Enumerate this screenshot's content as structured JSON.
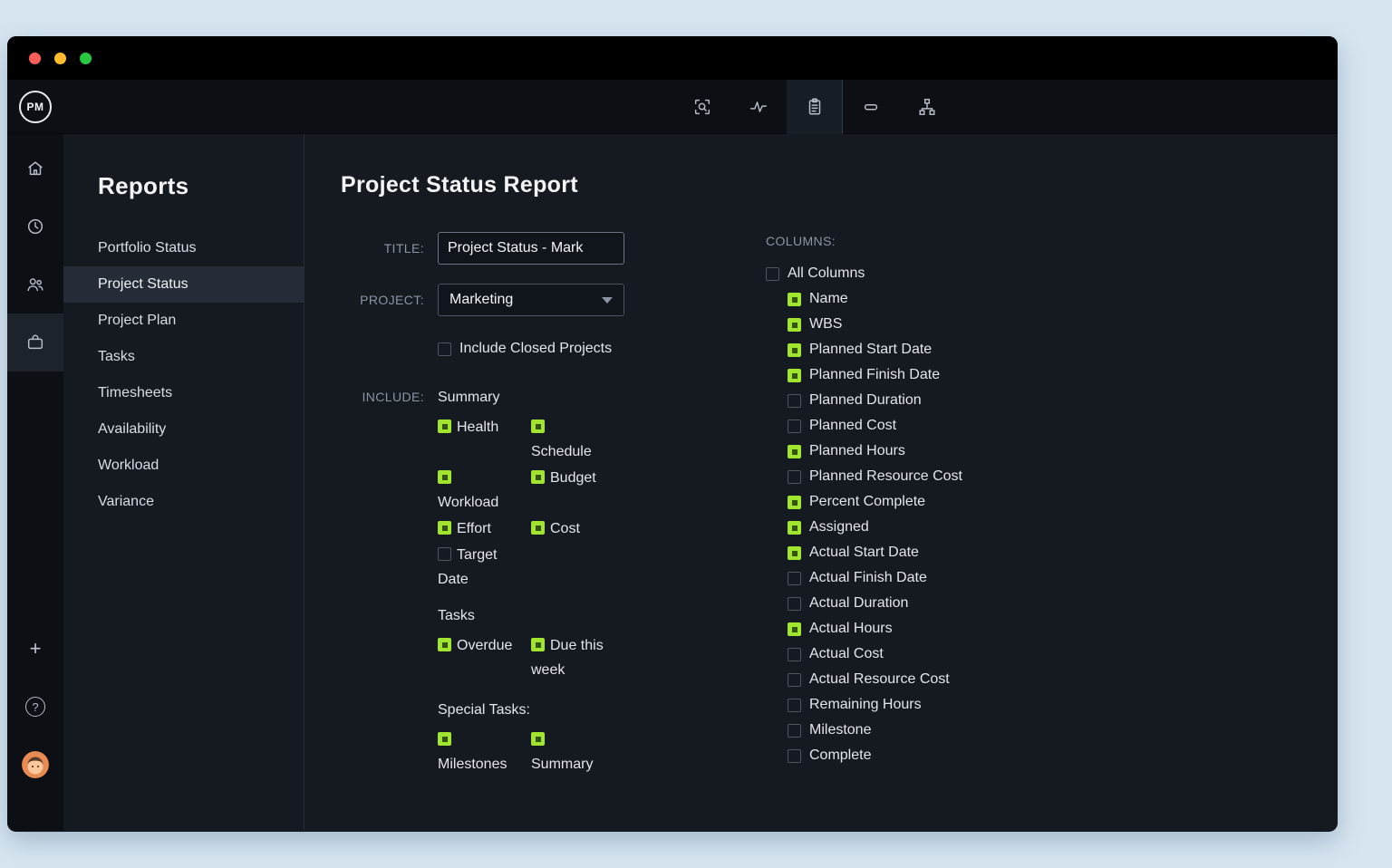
{
  "colors": {
    "page_bg": "#d7e5f0",
    "window_bg": "#151a21",
    "topbar_bg": "#0c0f14",
    "accent_green": "#a2e52f",
    "check_inner": "#33530e",
    "muted_label": "#8b94a3",
    "traffic_red": "#ff5f57",
    "traffic_yellow": "#febc2e",
    "traffic_green": "#28c840"
  },
  "window": {
    "logo_text": "PM",
    "topbar_icon_names": [
      "search-document-icon",
      "activity-icon",
      "report-clipboard-icon",
      "card-icon",
      "workflow-icon"
    ],
    "rail_icon_names": [
      "home-icon",
      "clock-icon",
      "people-icon",
      "briefcase-icon",
      "plus-icon",
      "help-icon",
      "avatar"
    ],
    "plus_glyph": "+",
    "help_glyph": "?"
  },
  "sidebar": {
    "title": "Reports",
    "items": [
      {
        "label": "Portfolio Status",
        "selected": false
      },
      {
        "label": "Project Status",
        "selected": true
      },
      {
        "label": "Project Plan",
        "selected": false
      },
      {
        "label": "Tasks",
        "selected": false
      },
      {
        "label": "Timesheets",
        "selected": false
      },
      {
        "label": "Availability",
        "selected": false
      },
      {
        "label": "Workload",
        "selected": false
      },
      {
        "label": "Variance",
        "selected": false
      }
    ]
  },
  "main": {
    "title": "Project Status Report",
    "form": {
      "title_label": "TITLE:",
      "title_value": "Project Status - Mark",
      "project_label": "PROJECT:",
      "project_value": "Marketing",
      "include_closed_label": "Include Closed Projects",
      "include_closed_checked": false,
      "include_label": "INCLUDE:",
      "summary_heading": "Summary",
      "summary_items": [
        {
          "label": "Health",
          "checked": true
        },
        {
          "label": "Schedule",
          "checked": true
        },
        {
          "label": "Workload",
          "checked": true
        },
        {
          "label": "Budget",
          "checked": true
        },
        {
          "label": "Effort",
          "checked": true
        },
        {
          "label": "Cost",
          "checked": true
        },
        {
          "label": "Target Date",
          "checked": false
        }
      ],
      "tasks_heading": "Tasks",
      "tasks_items": [
        {
          "label": "Overdue",
          "checked": true
        },
        {
          "label": "Due this week",
          "checked": true
        }
      ],
      "special_heading": "Special Tasks:",
      "special_items": [
        {
          "label": "Milestones",
          "checked": true
        },
        {
          "label": "Summary",
          "checked": true
        }
      ]
    },
    "columns": {
      "heading": "COLUMNS:",
      "all_label": "All Columns",
      "all_checked": false,
      "items": [
        {
          "label": "Name",
          "checked": true
        },
        {
          "label": "WBS",
          "checked": true
        },
        {
          "label": "Planned Start Date",
          "checked": true
        },
        {
          "label": "Planned Finish Date",
          "checked": true
        },
        {
          "label": "Planned Duration",
          "checked": false
        },
        {
          "label": "Planned Cost",
          "checked": false
        },
        {
          "label": "Planned Hours",
          "checked": true
        },
        {
          "label": "Planned Resource Cost",
          "checked": false
        },
        {
          "label": "Percent Complete",
          "checked": true
        },
        {
          "label": "Assigned",
          "checked": true
        },
        {
          "label": "Actual Start Date",
          "checked": true
        },
        {
          "label": "Actual Finish Date",
          "checked": false
        },
        {
          "label": "Actual Duration",
          "checked": false
        },
        {
          "label": "Actual Hours",
          "checked": true
        },
        {
          "label": "Actual Cost",
          "checked": false
        },
        {
          "label": "Actual Resource Cost",
          "checked": false
        },
        {
          "label": "Remaining Hours",
          "checked": false
        },
        {
          "label": "Milestone",
          "checked": false
        },
        {
          "label": "Complete",
          "checked": false
        }
      ]
    }
  }
}
